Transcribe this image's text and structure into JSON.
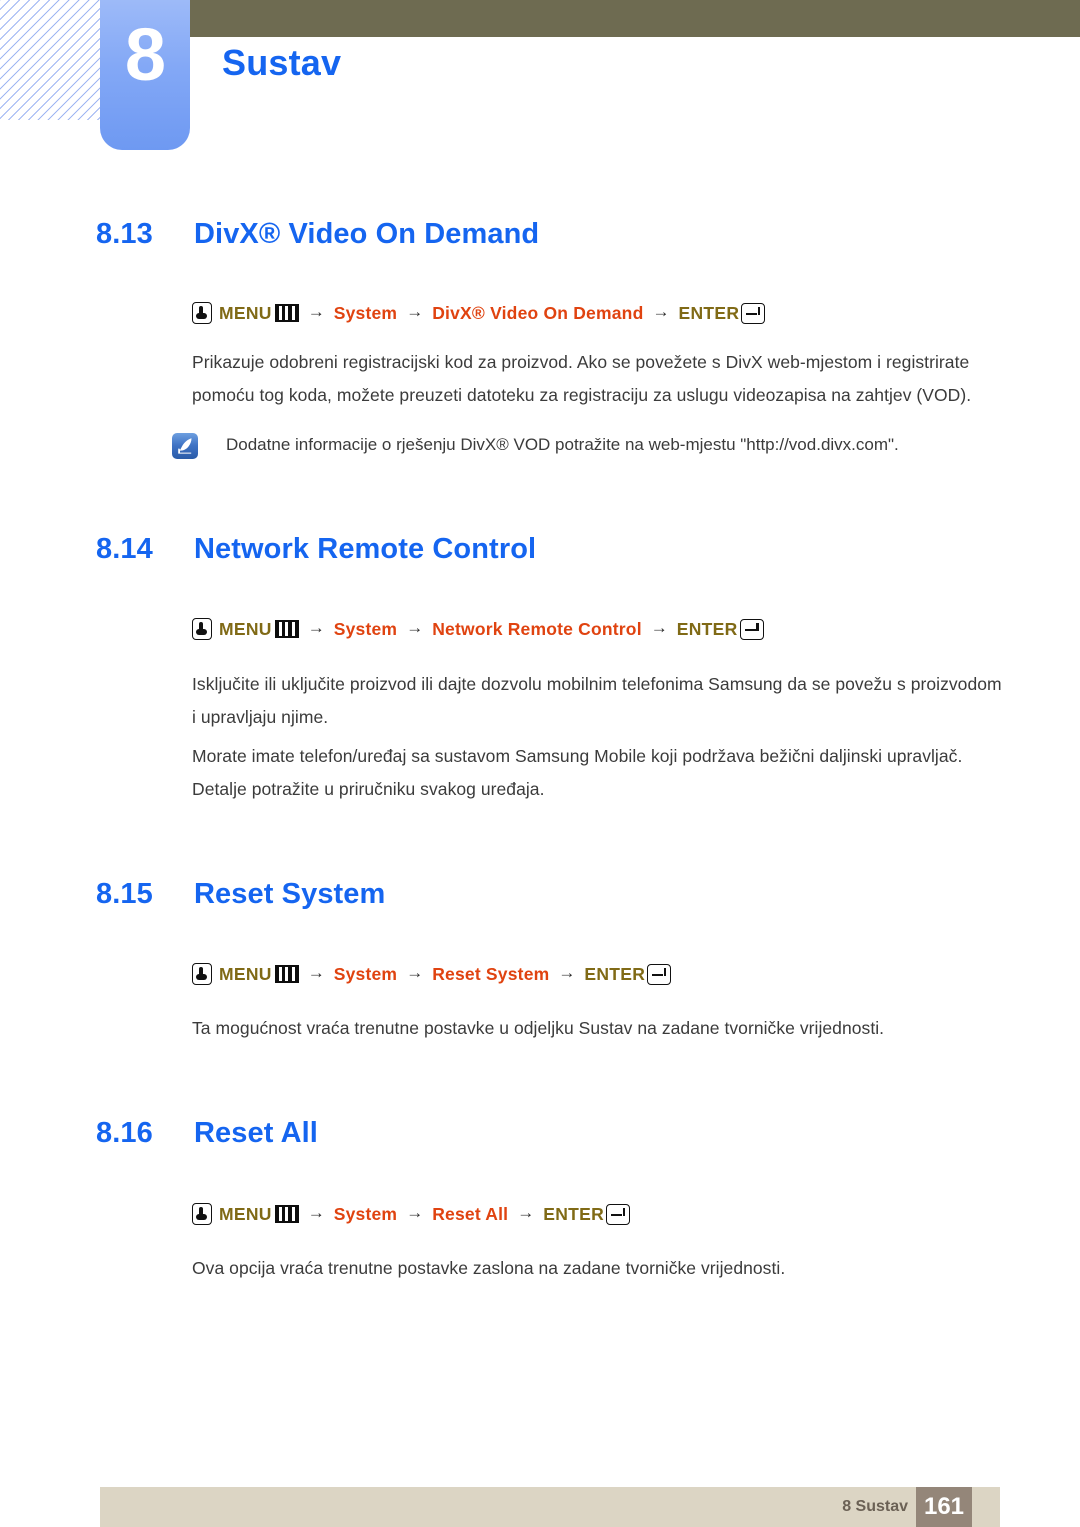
{
  "header": {
    "chapter_number": "8",
    "chapter_title": "Sustav",
    "accent_blue": "#1565f0",
    "olive_bar_color": "#6e6b51",
    "tab_blue": "#83a8f6"
  },
  "sections": [
    {
      "number": "8.13",
      "title": "DivX® Video On Demand",
      "menu_path": {
        "menu_label": "MENU",
        "enter_label": "ENTER",
        "arrow": "→",
        "items": [
          "System",
          "DivX® Video On Demand"
        ]
      },
      "paragraphs": [
        "Prikazuje odobreni registracijski kod za proizvod. Ako se povežete s DivX web-mjestom i registrirate pomoću tog koda, možete preuzeti datoteku za registraciju za uslugu videozapisa na zahtjev (VOD)."
      ],
      "note": "Dodatne informacije o rješenju DivX® VOD potražite na web-mjestu \"http://vod.divx.com\"."
    },
    {
      "number": "8.14",
      "title": "Network Remote Control",
      "menu_path": {
        "menu_label": "MENU",
        "enter_label": "ENTER",
        "arrow": "→",
        "items": [
          "System",
          "Network Remote Control"
        ]
      },
      "paragraphs": [
        "Isključite ili uključite proizvod ili dajte dozvolu mobilnim telefonima Samsung da se povežu s proizvodom i upravljaju njime.",
        "Morate imate telefon/uređaj sa sustavom Samsung Mobile koji podržava bežični daljinski upravljač. Detalje potražite u priručniku svakog uređaja."
      ]
    },
    {
      "number": "8.15",
      "title": "Reset System",
      "menu_path": {
        "menu_label": "MENU",
        "enter_label": "ENTER",
        "arrow": "→",
        "items": [
          "System",
          "Reset System"
        ]
      },
      "paragraphs": [
        "Ta mogućnost vraća trenutne postavke u odjeljku Sustav na zadane tvorničke vrijednosti."
      ]
    },
    {
      "number": "8.16",
      "title": "Reset All",
      "menu_path": {
        "menu_label": "MENU",
        "enter_label": "ENTER",
        "arrow": "→",
        "items": [
          "System",
          "Reset All"
        ]
      },
      "paragraphs": [
        "Ova opcija vraća trenutne postavke zaslona na zadane tvorničke vrijednosti."
      ]
    }
  ],
  "footer": {
    "label": "8 Sustav",
    "page_number": "161",
    "bar_color": "#dcd5c4",
    "page_box_color": "#948679"
  }
}
